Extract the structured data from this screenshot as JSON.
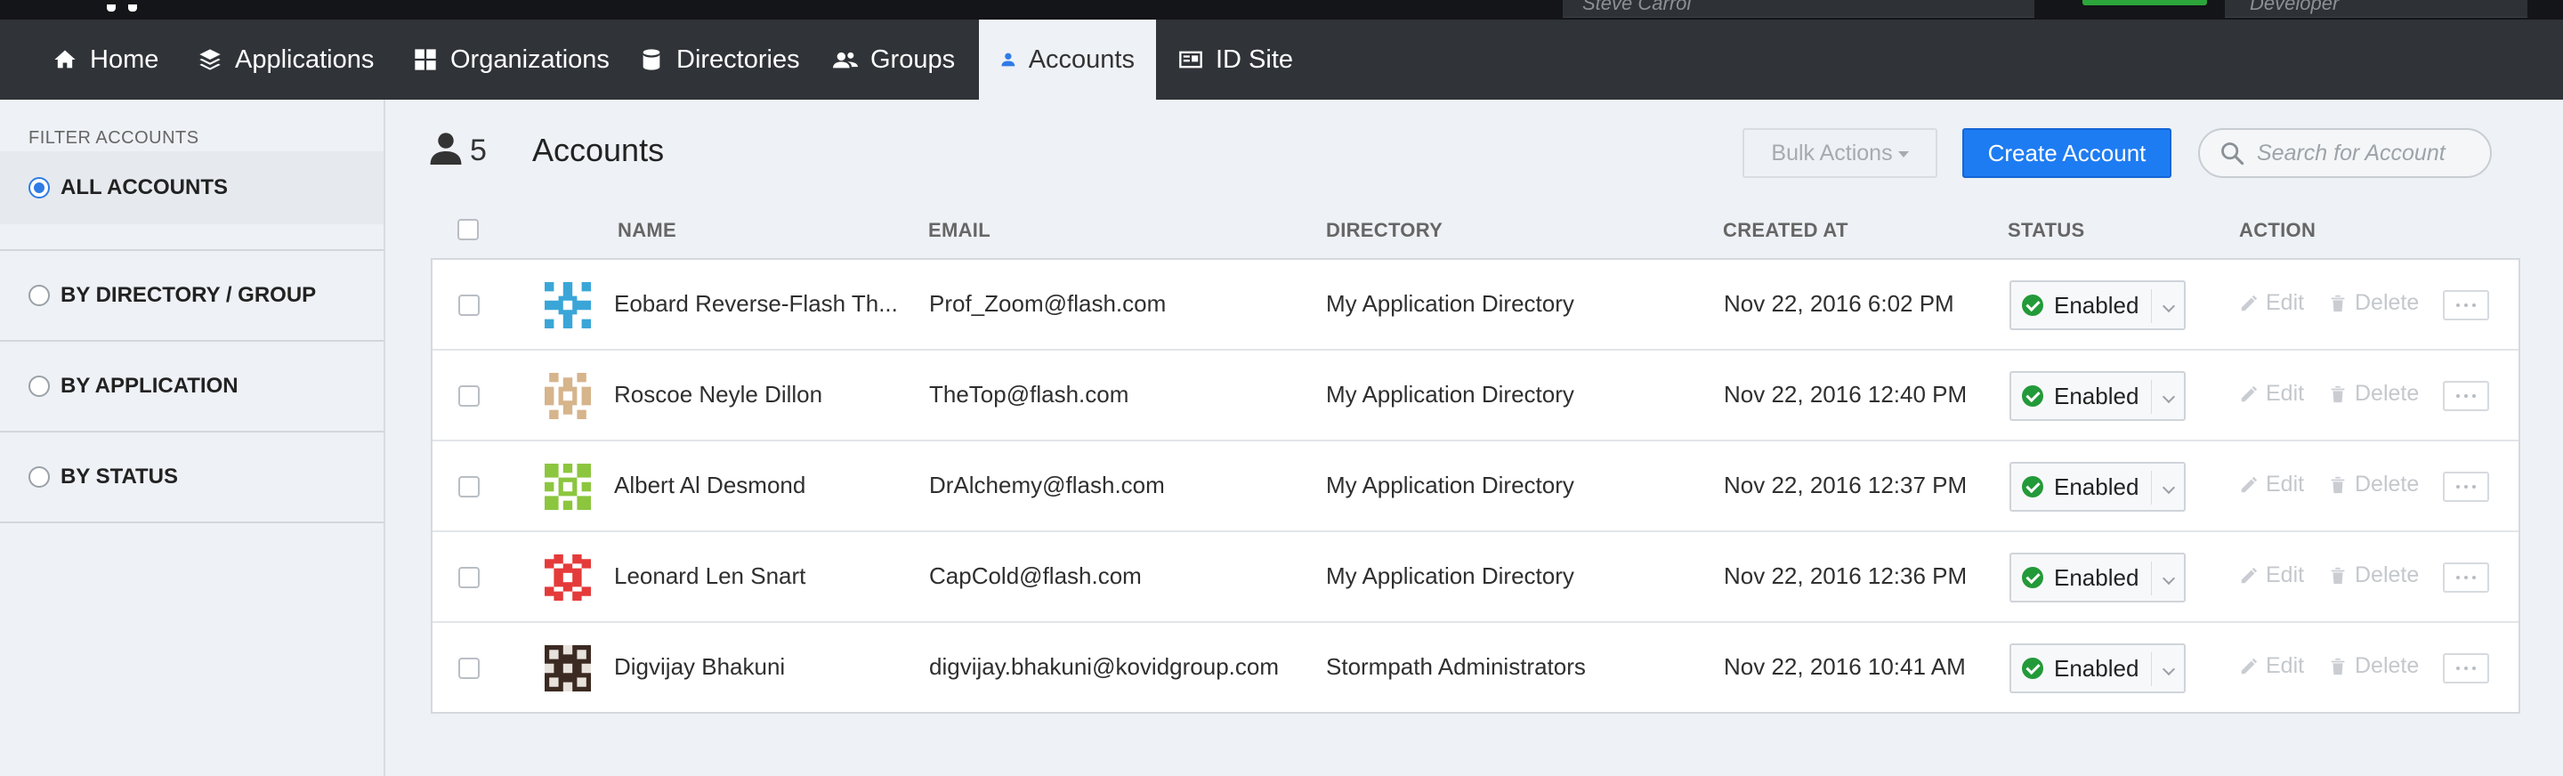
{
  "topbar": {
    "user_fragment": "Steve Carrol",
    "env_fragment": "Developer"
  },
  "nav": {
    "items": [
      {
        "label": "Home",
        "icon": "home-icon"
      },
      {
        "label": "Applications",
        "icon": "layers-icon"
      },
      {
        "label": "Organizations",
        "icon": "grid-icon"
      },
      {
        "label": "Directories",
        "icon": "database-icon"
      },
      {
        "label": "Groups",
        "icon": "users-icon"
      },
      {
        "label": "Accounts",
        "icon": "user-icon",
        "active": true
      },
      {
        "label": "ID Site",
        "icon": "id-card-icon"
      }
    ]
  },
  "sidebar": {
    "heading": "FILTER ACCOUNTS",
    "options": [
      {
        "label": "ALL ACCOUNTS",
        "selected": true
      },
      {
        "label": "BY DIRECTORY / GROUP",
        "selected": false
      },
      {
        "label": "BY APPLICATION",
        "selected": false
      },
      {
        "label": "BY STATUS",
        "selected": false
      }
    ]
  },
  "header": {
    "count": "5",
    "title": "Accounts",
    "bulk_actions_label": "Bulk Actions",
    "create_label": "Create Account",
    "search_placeholder": "Search for Account"
  },
  "table": {
    "columns": [
      "NAME",
      "EMAIL",
      "DIRECTORY",
      "CREATED AT",
      "STATUS",
      "ACTION"
    ],
    "action_labels": {
      "edit": "Edit",
      "delete": "Delete"
    },
    "rows": [
      {
        "name": "Eobard Reverse-Flash Th...",
        "email": "Prof_Zoom@flash.com",
        "directory": "My Application Directory",
        "created": "Nov 22, 2016 6:02 PM",
        "status": "Enabled",
        "avatar_color": "#3aa6d8"
      },
      {
        "name": "Roscoe Neyle Dillon",
        "email": "TheTop@flash.com",
        "directory": "My Application Directory",
        "created": "Nov 22, 2016 12:40 PM",
        "status": "Enabled",
        "avatar_color": "#d6b48c"
      },
      {
        "name": "Albert Al Desmond",
        "email": "DrAlchemy@flash.com",
        "directory": "My Application Directory",
        "created": "Nov 22, 2016 12:37 PM",
        "status": "Enabled",
        "avatar_color": "#8cc63f"
      },
      {
        "name": "Leonard Len Snart",
        "email": "CapCold@flash.com",
        "directory": "My Application Directory",
        "created": "Nov 22, 2016 12:36 PM",
        "status": "Enabled",
        "avatar_color": "#e53a3a"
      },
      {
        "name": "Digvijay Bhakuni",
        "email": "digvijay.bhakuni@kovidgroup.com",
        "directory": "Stormpath Administrators",
        "created": "Nov 22, 2016 10:41 AM",
        "status": "Enabled",
        "avatar_color": "#3b2a22"
      }
    ]
  },
  "colors": {
    "accent": "#1e7cf2",
    "nav_bg": "#303338",
    "enabled_green": "#239a39"
  }
}
